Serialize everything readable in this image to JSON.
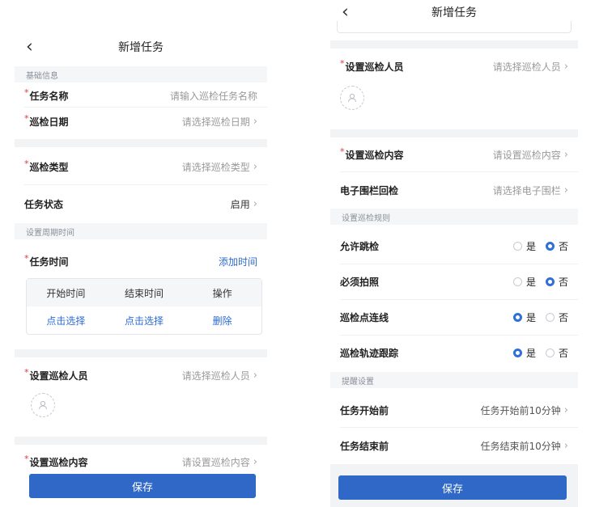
{
  "left": {
    "nav": {
      "back_icon": "‹",
      "title": "新增任务"
    },
    "basic_section": "基础信息",
    "task_name": {
      "label": "任务名称",
      "placeholder": "请输入巡检任务名称"
    },
    "inspect_date": {
      "label": "巡检日期",
      "value": "请选择巡检日期"
    },
    "inspect_type": {
      "label": "巡检类型",
      "value": "请选择巡检类型"
    },
    "task_status": {
      "label": "任务状态",
      "value": "启用"
    },
    "cycle_section": "设置周期时间",
    "task_time": {
      "label": "任务时间",
      "action": "添加时间"
    },
    "time_table": {
      "headers": [
        "开始时间",
        "结束时间",
        "操作"
      ],
      "row": [
        "点击选择",
        "点击选择",
        "删除"
      ]
    },
    "inspectors": {
      "label": "设置巡检人员",
      "value": "请选择巡检人员"
    },
    "content": {
      "label": "设置巡检内容",
      "value": "请设置巡检内容"
    },
    "save": "保存"
  },
  "right": {
    "nav": {
      "back_icon": "‹",
      "title": "新增任务"
    },
    "inspectors": {
      "label": "设置巡检人员",
      "value": "请选择巡检人员"
    },
    "content": {
      "label": "设置巡检内容",
      "value": "请设置巡检内容"
    },
    "geofence": {
      "label": "电子围栏回检",
      "value": "请选择电子围栏"
    },
    "rules_section": "设置巡检规则",
    "rules": [
      {
        "label": "允许跳检",
        "yes": "是",
        "no": "否",
        "selected": "no"
      },
      {
        "label": "必须拍照",
        "yes": "是",
        "no": "否",
        "selected": "no"
      },
      {
        "label": "巡检点连线",
        "yes": "是",
        "no": "否",
        "selected": "yes"
      },
      {
        "label": "巡检轨迹跟踪",
        "yes": "是",
        "no": "否",
        "selected": "yes"
      }
    ],
    "remind_section": "提醒设置",
    "before_start": {
      "label": "任务开始前",
      "value": "任务开始前10分钟"
    },
    "before_end": {
      "label": "任务结束前",
      "value": "任务结束前10分钟"
    },
    "save": "保存"
  },
  "colors": {
    "accent": "#2f68c6",
    "link": "#2d6ad6",
    "required": "#e03a3a",
    "section_bg": "#f5f6f8"
  },
  "icons": {
    "back": "chevron-left-icon",
    "chevron": "chevron-right-icon",
    "avatar": "user-placeholder-icon"
  }
}
